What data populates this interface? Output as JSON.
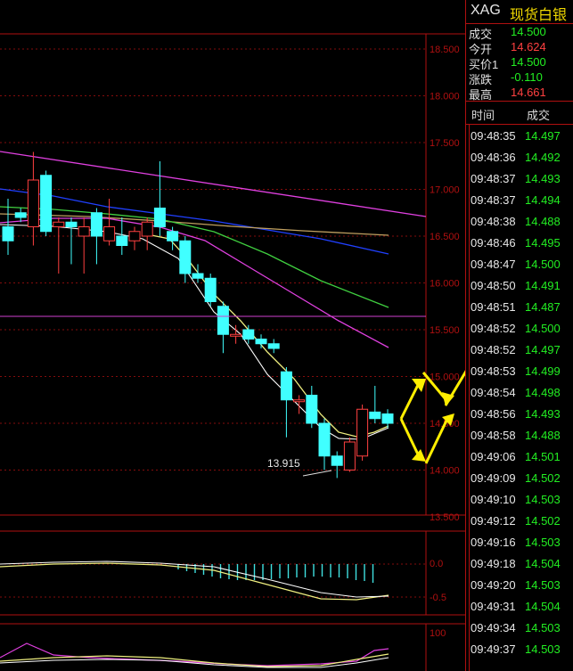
{
  "chart_data": {
    "type": "candlestick",
    "y_axis_labels": [
      "18.500",
      "18.000",
      "17.500",
      "17.000",
      "16.500",
      "16.000",
      "15.500",
      "15.000",
      "14.500",
      "14.000",
      "13.500"
    ],
    "min_annotation": "13.915",
    "candles": [
      {
        "o": 16.45,
        "h": 16.9,
        "l": 16.3,
        "c": 16.6,
        "up": false
      },
      {
        "o": 16.75,
        "h": 16.8,
        "l": 16.65,
        "c": 16.7,
        "up": false
      },
      {
        "o": 16.6,
        "h": 17.4,
        "l": 16.4,
        "c": 17.1,
        "up": true
      },
      {
        "o": 17.15,
        "h": 17.2,
        "l": 16.5,
        "c": 16.55,
        "up": false
      },
      {
        "o": 16.6,
        "h": 16.7,
        "l": 16.1,
        "c": 16.65,
        "up": true
      },
      {
        "o": 16.65,
        "h": 16.7,
        "l": 16.2,
        "c": 16.6,
        "up": false
      },
      {
        "o": 16.5,
        "h": 16.7,
        "l": 16.1,
        "c": 16.6,
        "up": true
      },
      {
        "o": 16.75,
        "h": 16.8,
        "l": 16.2,
        "c": 16.5,
        "up": false
      },
      {
        "o": 16.45,
        "h": 16.9,
        "l": 16.4,
        "c": 16.6,
        "up": true
      },
      {
        "o": 16.5,
        "h": 16.7,
        "l": 16.3,
        "c": 16.4,
        "up": false
      },
      {
        "o": 16.45,
        "h": 16.6,
        "l": 16.35,
        "c": 16.55,
        "up": true
      },
      {
        "o": 16.5,
        "h": 16.7,
        "l": 16.35,
        "c": 16.65,
        "up": true
      },
      {
        "o": 16.8,
        "h": 17.3,
        "l": 16.5,
        "c": 16.6,
        "up": false
      },
      {
        "o": 16.55,
        "h": 16.6,
        "l": 16.35,
        "c": 16.45,
        "up": false
      },
      {
        "o": 16.45,
        "h": 16.5,
        "l": 16.0,
        "c": 16.1,
        "up": false
      },
      {
        "o": 16.1,
        "h": 16.2,
        "l": 16.0,
        "c": 16.05,
        "up": false
      },
      {
        "o": 16.05,
        "h": 16.1,
        "l": 15.75,
        "c": 15.8,
        "up": false
      },
      {
        "o": 15.75,
        "h": 15.8,
        "l": 15.25,
        "c": 15.45,
        "up": false
      },
      {
        "o": 15.45,
        "h": 15.55,
        "l": 15.35,
        "c": 15.45,
        "up": true
      },
      {
        "o": 15.5,
        "h": 15.55,
        "l": 15.35,
        "c": 15.4,
        "up": false
      },
      {
        "o": 15.4,
        "h": 15.45,
        "l": 15.3,
        "c": 15.35,
        "up": false
      },
      {
        "o": 15.35,
        "h": 15.4,
        "l": 15.25,
        "c": 15.3,
        "up": false
      },
      {
        "o": 15.05,
        "h": 15.1,
        "l": 14.35,
        "c": 14.75,
        "up": false
      },
      {
        "o": 14.75,
        "h": 14.8,
        "l": 14.6,
        "c": 14.75,
        "up": true
      },
      {
        "o": 14.8,
        "h": 14.9,
        "l": 14.45,
        "c": 14.5,
        "up": false
      },
      {
        "o": 14.5,
        "h": 14.55,
        "l": 14.0,
        "c": 14.15,
        "up": false
      },
      {
        "o": 14.15,
        "h": 14.2,
        "l": 13.915,
        "c": 14.05,
        "up": false
      },
      {
        "o": 14.0,
        "h": 14.35,
        "l": 13.98,
        "c": 14.3,
        "up": true
      },
      {
        "o": 14.15,
        "h": 14.7,
        "l": 14.1,
        "c": 14.65,
        "up": true
      },
      {
        "o": 14.62,
        "h": 14.9,
        "l": 14.5,
        "c": 14.55,
        "up": false
      },
      {
        "o": 14.6,
        "h": 14.65,
        "l": 14.45,
        "c": 14.5,
        "up": false
      }
    ]
  },
  "indicator1": {
    "label_zero": "0.0",
    "label_neg": "-0.5"
  },
  "indicator2": {
    "label_top": "100"
  },
  "quote": {
    "code": "XAG",
    "name": "现货白银",
    "rows": [
      {
        "label": "成交",
        "value": "14.500",
        "color": "#22ee22"
      },
      {
        "label": "今开",
        "value": "14.624",
        "color": "#ff4040"
      },
      {
        "label": "买价1",
        "value": "14.500",
        "color": "#22ee22"
      },
      {
        "label": "涨跌",
        "value": "-0.110",
        "color": "#22ee22"
      },
      {
        "label": "最高",
        "value": "14.661",
        "color": "#ff4040"
      }
    ]
  },
  "ticks": {
    "header_time": "时间",
    "header_price": "成交",
    "rows": [
      {
        "time": "09:48:35",
        "price": "14.497"
      },
      {
        "time": "09:48:36",
        "price": "14.492"
      },
      {
        "time": "09:48:37",
        "price": "14.493"
      },
      {
        "time": "09:48:37",
        "price": "14.494"
      },
      {
        "time": "09:48:38",
        "price": "14.488"
      },
      {
        "time": "09:48:46",
        "price": "14.495"
      },
      {
        "time": "09:48:47",
        "price": "14.500"
      },
      {
        "time": "09:48:50",
        "price": "14.491"
      },
      {
        "time": "09:48:51",
        "price": "14.487"
      },
      {
        "time": "09:48:52",
        "price": "14.500"
      },
      {
        "time": "09:48:52",
        "price": "14.497"
      },
      {
        "time": "09:48:53",
        "price": "14.499"
      },
      {
        "time": "09:48:54",
        "price": "14.498"
      },
      {
        "time": "09:48:56",
        "price": "14.493"
      },
      {
        "time": "09:48:58",
        "price": "14.488"
      },
      {
        "time": "09:49:06",
        "price": "14.501"
      },
      {
        "time": "09:49:09",
        "price": "14.502"
      },
      {
        "time": "09:49:10",
        "price": "14.503"
      },
      {
        "time": "09:49:12",
        "price": "14.502"
      },
      {
        "time": "09:49:16",
        "price": "14.503"
      },
      {
        "time": "09:49:18",
        "price": "14.504"
      },
      {
        "time": "09:49:20",
        "price": "14.503"
      },
      {
        "time": "09:49:31",
        "price": "14.504"
      },
      {
        "time": "09:49:34",
        "price": "14.503"
      },
      {
        "time": "09:49:37",
        "price": "14.503"
      }
    ]
  }
}
